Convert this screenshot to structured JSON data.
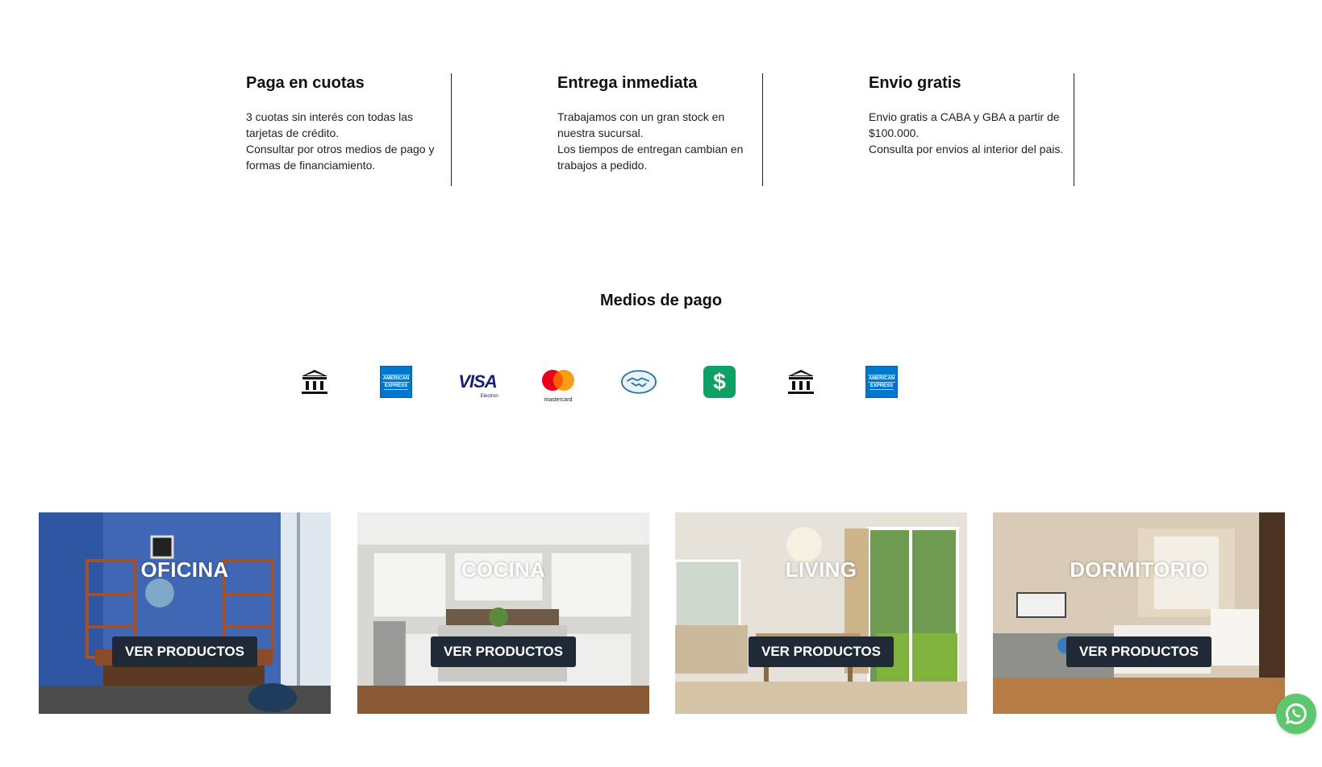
{
  "features": [
    {
      "title": "Paga en cuotas",
      "lines": [
        "3 cuotas sin interés con todas las tarjetas de crédito.",
        "Consultar por otros medios de pago y formas de financiamiento."
      ]
    },
    {
      "title": "Entrega inmediata",
      "lines": [
        "Trabajamos con un gran stock en nuestra sucursal.",
        "Los tiempos de entregan cambian en trabajos a pedido."
      ]
    },
    {
      "title": "Envio gratis",
      "lines": [
        "Envio gratis a CABA y GBA a partir de $100.000.",
        "Consulta por envios al interior del pais."
      ]
    }
  ],
  "payments": {
    "title": "Medios de pago",
    "methods": [
      {
        "icon": "bank-icon"
      },
      {
        "icon": "amex-icon",
        "label_top": "AMERICAN",
        "label_bottom": "EXPRESS"
      },
      {
        "icon": "visa-icon",
        "label": "VISA",
        "sub": "Electron"
      },
      {
        "icon": "mastercard-icon",
        "label": "mastercard"
      },
      {
        "icon": "mercadopago-icon"
      },
      {
        "icon": "cash-icon",
        "label": "$"
      },
      {
        "icon": "bank-icon"
      },
      {
        "icon": "amex-icon",
        "label_top": "AMERICAN",
        "label_bottom": "EXPRESS"
      }
    ]
  },
  "categories": [
    {
      "title": "OFICINA",
      "button": "VER PRODUCTOS"
    },
    {
      "title": "COCINA",
      "button": "VER PRODUCTOS"
    },
    {
      "title": "LIVING",
      "button": "VER PRODUCTOS"
    },
    {
      "title": "DORMITORIO",
      "button": "VER PRODUCTOS"
    }
  ],
  "colors": {
    "button_bg": "#1f2a36",
    "whatsapp": "#5ec76e",
    "amex": "#0077cc",
    "visa": "#1a1f71",
    "cash": "#0fa163"
  }
}
